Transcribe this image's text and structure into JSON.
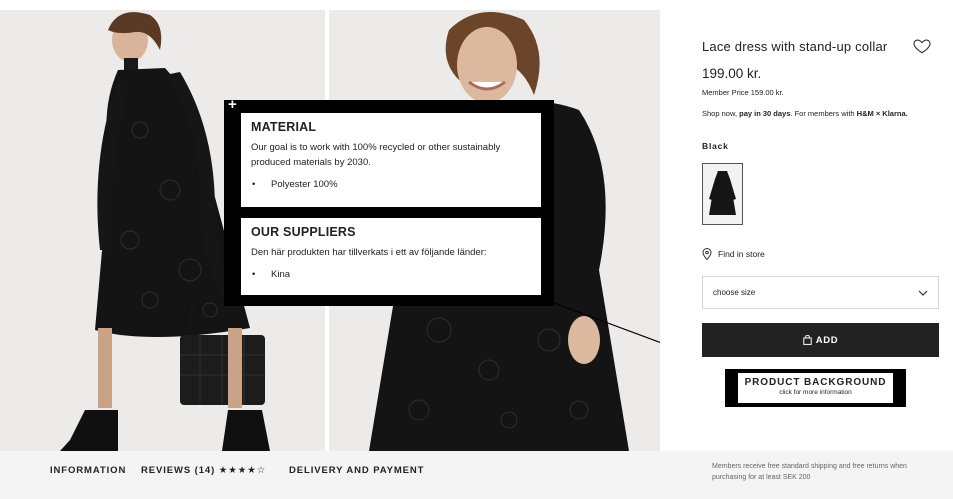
{
  "product": {
    "title": "Lace dress with stand-up collar",
    "price": "199.00 kr.",
    "member_price": "Member Price 159.00 kr.",
    "klarna_prefix": "Shop now, ",
    "klarna_bold": "pay in 30 days",
    "klarna_suffix": ". For members with ",
    "klarna_brand": "H&M × Klarna.",
    "color_label": "Black",
    "find_in_store": "Find in store",
    "size_placeholder": "choose size",
    "add_label": "ADD"
  },
  "overlay": {
    "material_heading": "MATERIAL",
    "material_text": "Our goal is to work with 100% recycled or other sustainably produced materials by 2030.",
    "material_items": [
      "Polyester 100%"
    ],
    "suppliers_heading": "OUR SUPPLIERS",
    "suppliers_text": "Den här produkten har tillverkats i ett av följande länder:",
    "suppliers_items": [
      "Kina"
    ],
    "plus_symbol": "+"
  },
  "callout": {
    "title": "PRODUCT BACKGROUND",
    "subtitle": "click for more information"
  },
  "bottom_bar": {
    "tab_information": "INFORMATION",
    "tab_reviews": "REVIEWS (14)",
    "review_stars": "★★★★☆",
    "review_rating": 4,
    "tab_delivery": "DELIVERY AND PAYMENT",
    "shipping_note": "Members receive free standard shipping and free returns when purchasing for at least SEK 200"
  },
  "icons": {
    "heart": "heart-icon",
    "location": "location-pin-icon",
    "chevron": "chevron-down-icon",
    "bag": "shopping-bag-icon",
    "plus": "plus-icon"
  }
}
